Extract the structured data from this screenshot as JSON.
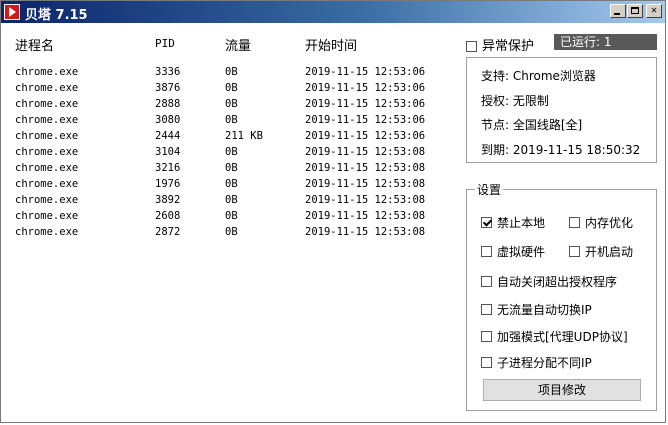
{
  "window": {
    "title": "贝塔 7.15"
  },
  "process_list": {
    "headers": {
      "name": "进程名",
      "pid": "PID",
      "flow": "流量",
      "start_time": "开始时间"
    },
    "rows": [
      {
        "name": "chrome.exe",
        "pid": "3336",
        "flow": "0B",
        "time": "2019-11-15 12:53:06"
      },
      {
        "name": "chrome.exe",
        "pid": "3876",
        "flow": "0B",
        "time": "2019-11-15 12:53:06"
      },
      {
        "name": "chrome.exe",
        "pid": "2888",
        "flow": "0B",
        "time": "2019-11-15 12:53:06"
      },
      {
        "name": "chrome.exe",
        "pid": "3080",
        "flow": "0B",
        "time": "2019-11-15 12:53:06"
      },
      {
        "name": "chrome.exe",
        "pid": "2444",
        "flow": "211 KB",
        "time": "2019-11-15 12:53:06"
      },
      {
        "name": "chrome.exe",
        "pid": "3104",
        "flow": "0B",
        "time": "2019-11-15 12:53:08"
      },
      {
        "name": "chrome.exe",
        "pid": "3216",
        "flow": "0B",
        "time": "2019-11-15 12:53:08"
      },
      {
        "name": "chrome.exe",
        "pid": "1976",
        "flow": "0B",
        "time": "2019-11-15 12:53:08"
      },
      {
        "name": "chrome.exe",
        "pid": "3892",
        "flow": "0B",
        "time": "2019-11-15 12:53:08"
      },
      {
        "name": "chrome.exe",
        "pid": "2608",
        "flow": "0B",
        "time": "2019-11-15 12:53:08"
      },
      {
        "name": "chrome.exe",
        "pid": "2872",
        "flow": "0B",
        "time": "2019-11-15 12:53:08"
      }
    ]
  },
  "right_panel": {
    "abnormal_protect": {
      "label": "异常保护",
      "checked": false
    },
    "running": "已运行: 1",
    "info": {
      "support": "支持: Chrome浏览器",
      "auth": "授权: 无限制",
      "node": "节点: 全国线路[全]",
      "expire": "到期: 2019-11-15 18:50:32"
    },
    "settings": {
      "title": "设置",
      "options": {
        "disable_local": {
          "label": "禁止本地",
          "checked": true
        },
        "mem_optimize": {
          "label": "内存优化",
          "checked": false
        },
        "virtual_hw": {
          "label": "虚拟硬件",
          "checked": false
        },
        "boot_start": {
          "label": "开机启动",
          "checked": false
        },
        "auto_close": {
          "label": "自动关闭超出授权程序",
          "checked": false
        },
        "auto_switch_ip": {
          "label": "无流量自动切换IP",
          "checked": false
        },
        "enhanced_mode": {
          "label": "加强模式[代理UDP协议]",
          "checked": false
        },
        "child_diff_ip": {
          "label": "子进程分配不同IP",
          "checked": false
        }
      },
      "edit_button": "项目修改"
    }
  }
}
